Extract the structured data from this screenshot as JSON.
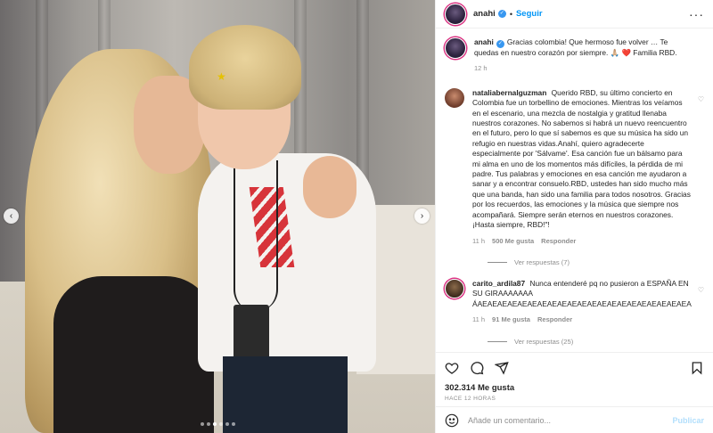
{
  "post": {
    "header": {
      "username": "anahi",
      "follow_label": "Seguir",
      "separator": "•"
    },
    "caption": {
      "username": "anahi",
      "text": "Gracias colombia! Que hermoso fue volver … Te quedas en nuestro corazón por siempre. 🙏🏼 ❤️ Familia RBD.",
      "time": "12 h"
    },
    "comments": [
      {
        "username": "nataliabernalguzman",
        "text": "Querido RBD, su último concierto en Colombia fue un torbellino de emociones. Mientras los veíamos en el escenario, una mezcla de nostalgia y gratitud llenaba nuestros corazones. No sabemos si habrá un nuevo reencuentro en el futuro, pero lo que sí sabemos es que su música ha sido un refugio en nuestras vidas.Anahí, quiero agradecerte especialmente por 'Sálvame'. Esa canción fue un bálsamo para mi alma en uno de los momentos más difíciles, la pérdida de mi padre. Tus palabras y emociones en esa canción me ayudaron a sanar y a encontrar consuelo.RBD, ustedes han sido mucho más que una banda, han sido una familia para todos nosotros. Gracias por los recuerdos, las emociones y la música que siempre nos acompañará. Siempre serán eternos en nuestros corazones. ¡Hasta siempre, RBD!\"!",
        "time": "11 h",
        "likes": "500 Me gusta",
        "reply_label": "Responder",
        "view_replies": "Ver respuestas (7)"
      },
      {
        "username": "carito_ardila87",
        "text": "Nunca entenderé pq no pusieron a ESPAÑA EN SU GIRAAAAAAA ÁAEAEAEAEAEAEAEAEAEAEAEAEAEAEAEAEAEAEAEAEAEA",
        "time": "11 h",
        "likes": "91 Me gusta",
        "reply_label": "Responder",
        "view_replies": "Ver respuestas (25)"
      }
    ],
    "likes_count": "302.314 Me gusta",
    "posted_ago": "HACE 12 HORAS",
    "comment_placeholder": "Añade un comentario...",
    "publish_label": "Publicar",
    "carousel": {
      "total_slides": 6,
      "active_slide": 2
    },
    "colors": {
      "follow_blue": "#0095f6",
      "story_ring": "#d92e7f",
      "muted": "#8e8e8e",
      "publish_disabled": "#b2dffc"
    },
    "icons": [
      "more-icon",
      "heart-icon",
      "comment-icon",
      "share-icon",
      "bookmark-icon",
      "emoji-icon",
      "verified-icon",
      "chevron-left-icon",
      "chevron-right-icon"
    ]
  }
}
